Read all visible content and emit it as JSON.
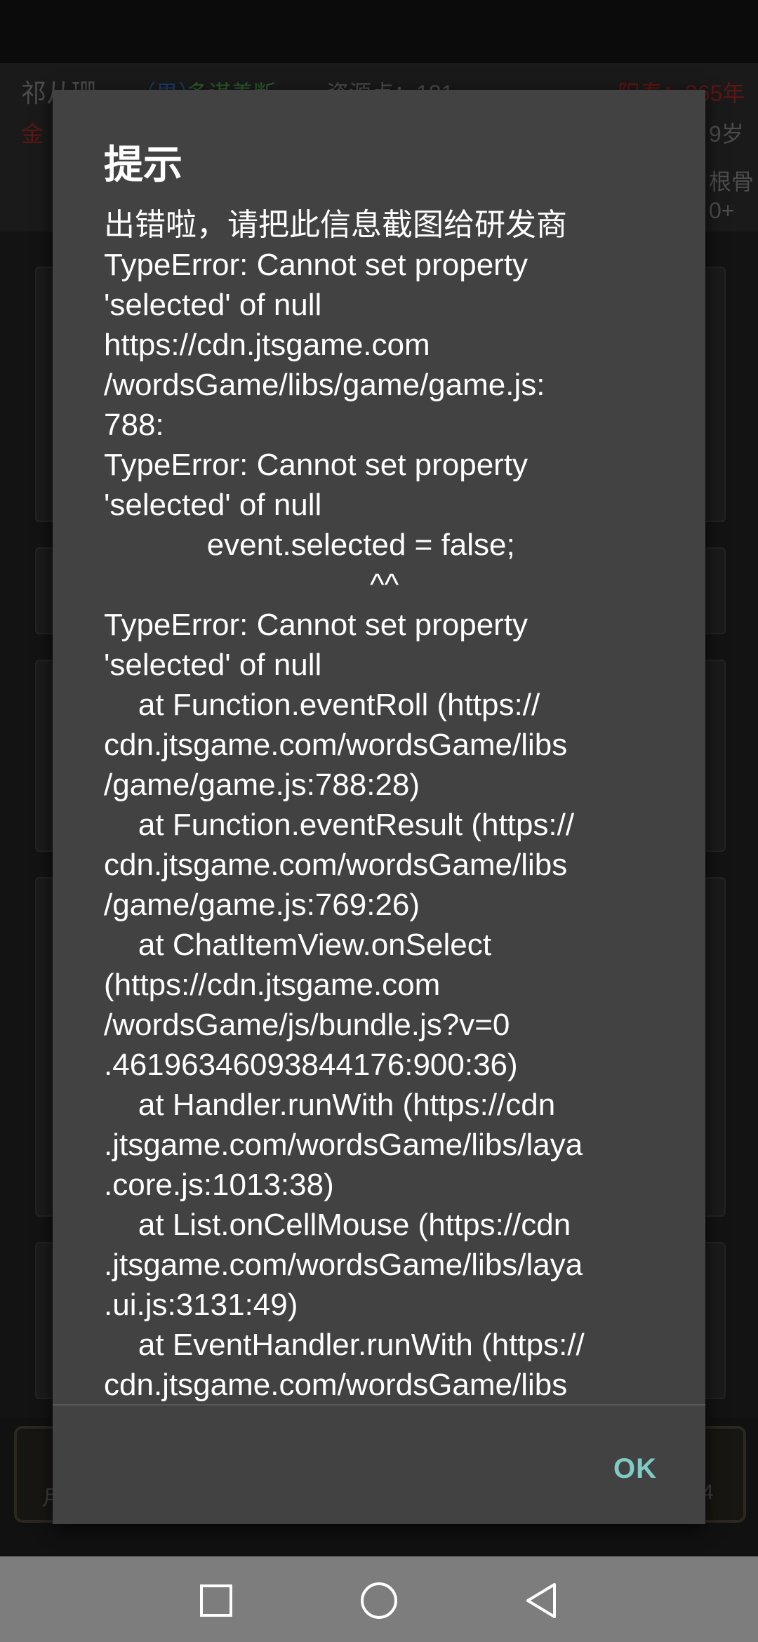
{
  "background_game": {
    "player_name": "祁从珊",
    "gender": "（男）",
    "trait": "多谋善断",
    "resource_label": "资源点：181",
    "lifespan": "阳寿：265年",
    "sub_left": "金",
    "age_fragment": "9岁",
    "right_fragment_1": "根骨",
    "right_fragment_2": "0+",
    "tab_label_left": "月",
    "tab_label_right": "4"
  },
  "dialog": {
    "title": "提示",
    "lines": [
      "出错啦，请把此信息截图给研发商",
      "TypeError: Cannot set property",
      "'selected' of null",
      "https://cdn.jtsgame.com",
      "/wordsGame/libs/game/game.js:",
      "788:",
      "TypeError: Cannot set property",
      "'selected' of null",
      "            event.selected = false;",
      "                               ^^",
      "TypeError: Cannot set property",
      "'selected' of null",
      "    at Function.eventRoll (https://",
      "cdn.jtsgame.com/wordsGame/libs",
      "/game/game.js:788:28)",
      "    at Function.eventResult (https://",
      "cdn.jtsgame.com/wordsGame/libs",
      "/game/game.js:769:26)",
      "    at ChatItemView.onSelect",
      "(https://cdn.jtsgame.com",
      "/wordsGame/js/bundle.js?v=0",
      ".46196346093844176:900:36)",
      "    at Handler.runWith (https://cdn",
      ".jtsgame.com/wordsGame/libs/laya",
      ".core.js:1013:38)",
      "    at List.onCellMouse (https://cdn",
      ".jtsgame.com/wordsGame/libs/laya",
      ".ui.js:3131:49)",
      "    at EventHandler.runWith (https://",
      "cdn.jtsgame.com/wordsGame/libs"
    ],
    "ok_label": "OK"
  },
  "navbar": {
    "icons": [
      "square-recents-icon",
      "circle-home-icon",
      "triangle-back-icon"
    ],
    "color": "#7d7d7d"
  },
  "colors": {
    "dialog_bg": "#424242",
    "accent": "#80cbc4",
    "text": "#ffffff"
  }
}
